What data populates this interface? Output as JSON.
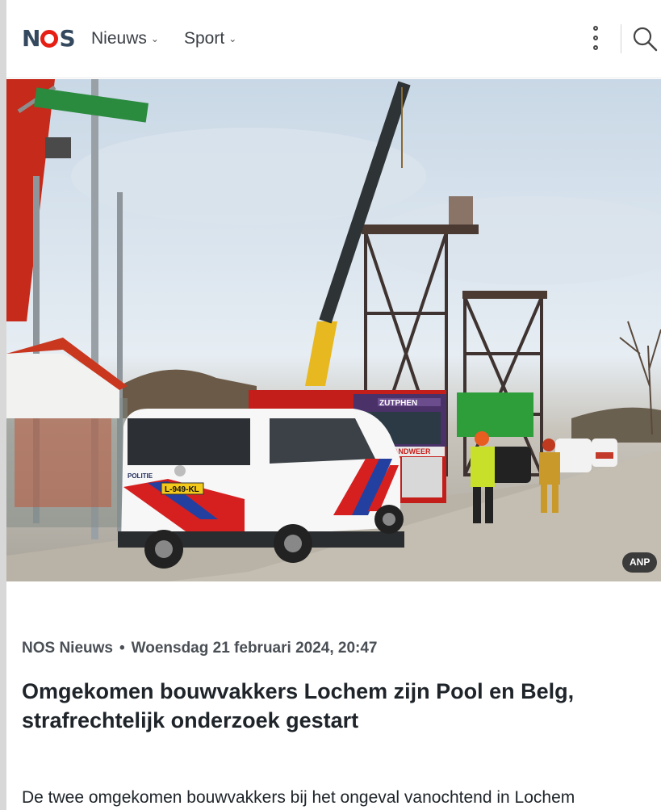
{
  "header": {
    "logo_text": "NOS",
    "nav": [
      {
        "label": "Nieuws"
      },
      {
        "label": "Sport"
      }
    ],
    "icons": [
      "kebab-menu-icon",
      "search-icon"
    ]
  },
  "hero": {
    "credit": "ANP",
    "vehicle_texts": {
      "police_label": "POLITIE",
      "plate": "L-949-KL",
      "truck_banner": "ZUTPHEN",
      "brandweer": "BRANDWEER"
    }
  },
  "article": {
    "source": "NOS Nieuws",
    "separator": "•",
    "date": "Woensdag 21 februari 2024, 20:47",
    "headline": "Omgekomen bouwvakkers Lochem zijn Pool en Belg, strafrechtelijk onderzoek gestart",
    "lead": "De twee omgekomen bouwvakkers bij het ongeval vanochtend in Lochem"
  },
  "colors": {
    "brand_red": "#e61e14",
    "logo_dark": "#34495e",
    "text": "#1e2429"
  }
}
